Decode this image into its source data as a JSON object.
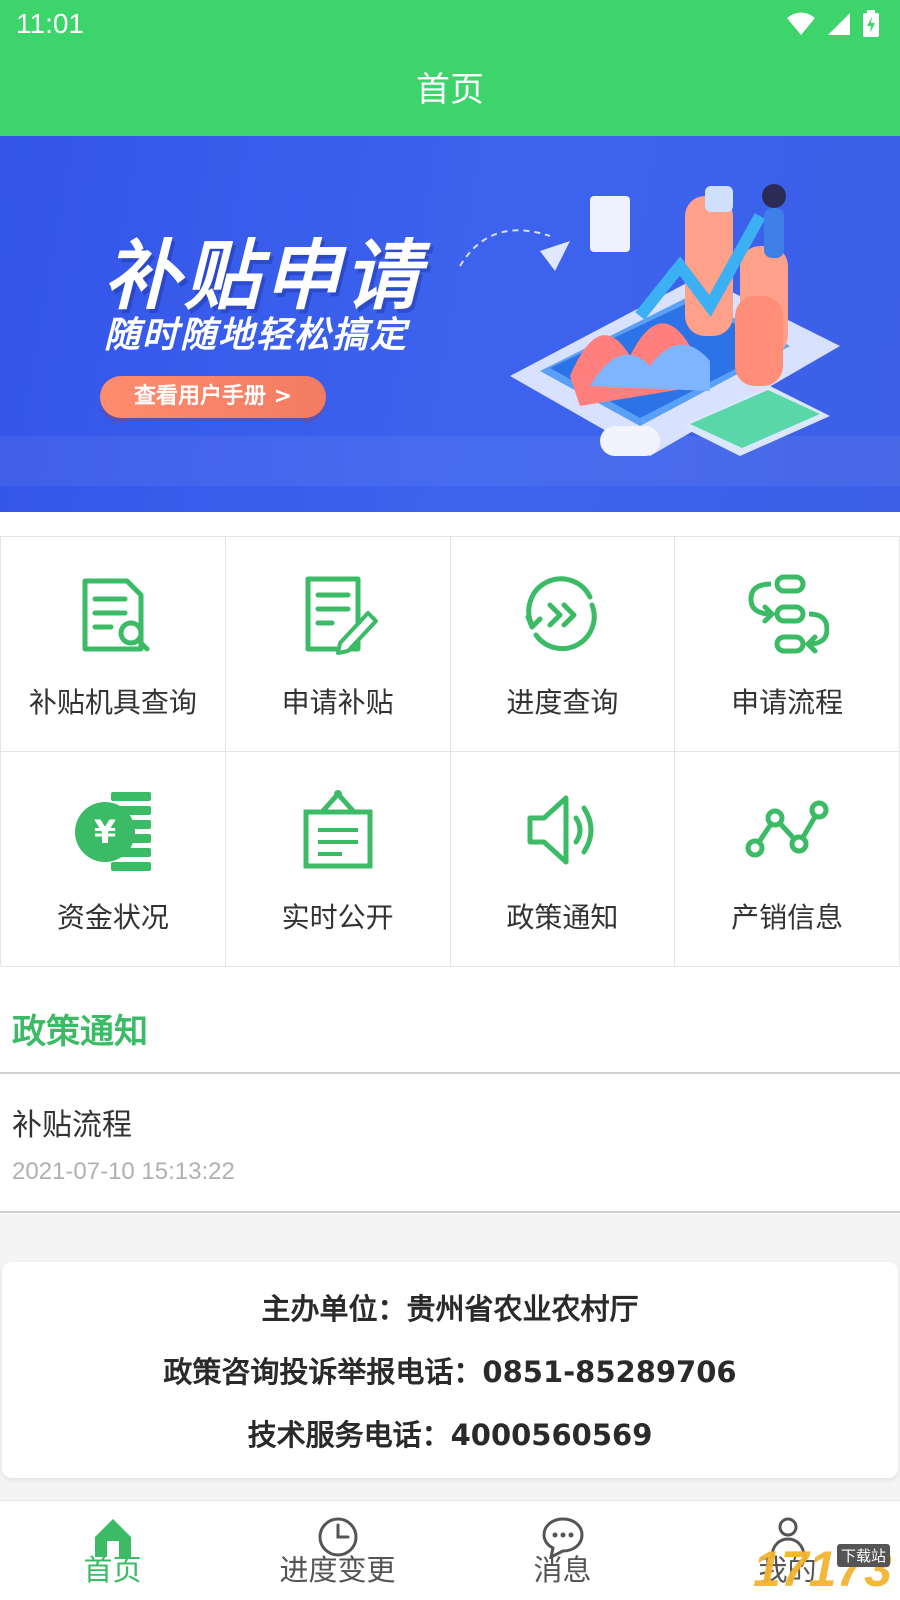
{
  "status_bar": {
    "time": "11:01"
  },
  "header": {
    "title": "首页"
  },
  "banner": {
    "title": "补贴申请",
    "subtitle": "随时随地轻松搞定",
    "button_label": "查看用户手册 >"
  },
  "grid": {
    "items": [
      {
        "label": "补贴机具查询",
        "icon": "document-search-icon"
      },
      {
        "label": "申请补贴",
        "icon": "document-edit-icon"
      },
      {
        "label": "进度查询",
        "icon": "progress-arrows-icon"
      },
      {
        "label": "申请流程",
        "icon": "process-flow-icon"
      },
      {
        "label": "资金状况",
        "icon": "yuan-coin-icon"
      },
      {
        "label": "实时公开",
        "icon": "notice-board-icon"
      },
      {
        "label": "政策通知",
        "icon": "speaker-icon"
      },
      {
        "label": "产销信息",
        "icon": "line-trend-icon"
      }
    ]
  },
  "policy": {
    "section_title": "政策通知",
    "items": [
      {
        "title": "补贴流程",
        "time": "2021-07-10 15:13:22"
      }
    ]
  },
  "footer": {
    "sponsor": "主办单位：贵州省农业农村厅",
    "complaint_phone": "政策咨询投诉举报电话：0851-85289706",
    "tech_phone": "技术服务电话：4000560569"
  },
  "tabbar": {
    "tabs": [
      {
        "label": "首页",
        "icon": "home-icon",
        "active": true
      },
      {
        "label": "进度变更",
        "icon": "clock-icon",
        "active": false
      },
      {
        "label": "消息",
        "icon": "chat-bubble-icon",
        "active": false
      },
      {
        "label": "我的",
        "icon": "user-icon",
        "active": false
      }
    ]
  },
  "watermark": {
    "text": "17173",
    "sub": "下载站"
  },
  "colors": {
    "brand_green": "#3dd46c",
    "accent_green": "#3cbb66",
    "banner_blue": "#3d63ee",
    "button_orange": "#f37b61"
  }
}
